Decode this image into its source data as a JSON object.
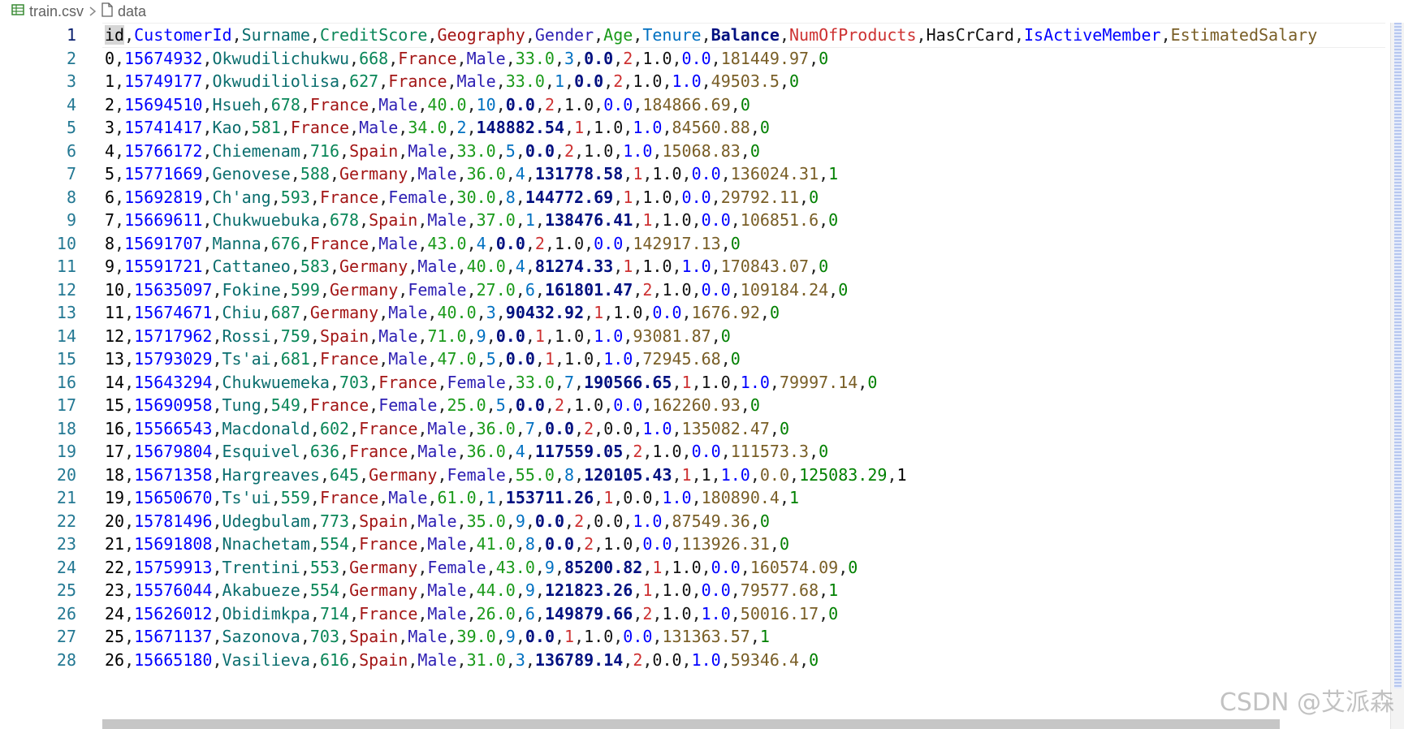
{
  "breadcrumb": {
    "file": "train.csv",
    "symbol": "data",
    "file_icon": "table-icon",
    "symbol_icon": "file-icon"
  },
  "colors": {
    "line_number": "#237893",
    "line_number_active": "#0b216f",
    "columns": [
      "#000000",
      "#0000ff",
      "#0b6e6e",
      "#098658",
      "#a31515",
      "#2d1fb3",
      "#1a9a1a",
      "#0070c1",
      "#001080",
      "#cd3131",
      "#111111",
      "#0000ff",
      "#795e26",
      "#008000"
    ]
  },
  "editor": {
    "header": [
      "id",
      "CustomerId",
      "Surname",
      "CreditScore",
      "Geography",
      "Gender",
      "Age",
      "Tenure",
      "Balance",
      "NumOfProducts",
      "HasCrCard",
      "IsActiveMember",
      "EstimatedSalary"
    ],
    "rows": [
      [
        "0",
        "15674932",
        "Okwudilichukwu",
        "668",
        "France",
        "Male",
        "33.0",
        "3",
        "0.0",
        "2",
        "1.0",
        "0.0",
        "181449.97",
        "0"
      ],
      [
        "1",
        "15749177",
        "Okwudiliolisa",
        "627",
        "France",
        "Male",
        "33.0",
        "1",
        "0.0",
        "2",
        "1.0",
        "1.0",
        "49503.5",
        "0"
      ],
      [
        "2",
        "15694510",
        "Hsueh",
        "678",
        "France",
        "Male",
        "40.0",
        "10",
        "0.0",
        "2",
        "1.0",
        "0.0",
        "184866.69",
        "0"
      ],
      [
        "3",
        "15741417",
        "Kao",
        "581",
        "France",
        "Male",
        "34.0",
        "2",
        "148882.54",
        "1",
        "1.0",
        "1.0",
        "84560.88",
        "0"
      ],
      [
        "4",
        "15766172",
        "Chiemenam",
        "716",
        "Spain",
        "Male",
        "33.0",
        "5",
        "0.0",
        "2",
        "1.0",
        "1.0",
        "15068.83",
        "0"
      ],
      [
        "5",
        "15771669",
        "Genovese",
        "588",
        "Germany",
        "Male",
        "36.0",
        "4",
        "131778.58",
        "1",
        "1.0",
        "0.0",
        "136024.31",
        "1"
      ],
      [
        "6",
        "15692819",
        "Ch'ang",
        "593",
        "France",
        "Female",
        "30.0",
        "8",
        "144772.69",
        "1",
        "1.0",
        "0.0",
        "29792.11",
        "0"
      ],
      [
        "7",
        "15669611",
        "Chukwuebuka",
        "678",
        "Spain",
        "Male",
        "37.0",
        "1",
        "138476.41",
        "1",
        "1.0",
        "0.0",
        "106851.6",
        "0"
      ],
      [
        "8",
        "15691707",
        "Manna",
        "676",
        "France",
        "Male",
        "43.0",
        "4",
        "0.0",
        "2",
        "1.0",
        "0.0",
        "142917.13",
        "0"
      ],
      [
        "9",
        "15591721",
        "Cattaneo",
        "583",
        "Germany",
        "Male",
        "40.0",
        "4",
        "81274.33",
        "1",
        "1.0",
        "1.0",
        "170843.07",
        "0"
      ],
      [
        "10",
        "15635097",
        "Fokine",
        "599",
        "Germany",
        "Female",
        "27.0",
        "6",
        "161801.47",
        "2",
        "1.0",
        "0.0",
        "109184.24",
        "0"
      ],
      [
        "11",
        "15674671",
        "Chiu",
        "687",
        "Germany",
        "Male",
        "40.0",
        "3",
        "90432.92",
        "1",
        "1.0",
        "0.0",
        "1676.92",
        "0"
      ],
      [
        "12",
        "15717962",
        "Rossi",
        "759",
        "Spain",
        "Male",
        "71.0",
        "9",
        "0.0",
        "1",
        "1.0",
        "1.0",
        "93081.87",
        "0"
      ],
      [
        "13",
        "15793029",
        "Ts'ai",
        "681",
        "France",
        "Male",
        "47.0",
        "5",
        "0.0",
        "1",
        "1.0",
        "1.0",
        "72945.68",
        "0"
      ],
      [
        "14",
        "15643294",
        "Chukwuemeka",
        "703",
        "France",
        "Female",
        "33.0",
        "7",
        "190566.65",
        "1",
        "1.0",
        "1.0",
        "79997.14",
        "0"
      ],
      [
        "15",
        "15690958",
        "Tung",
        "549",
        "France",
        "Female",
        "25.0",
        "5",
        "0.0",
        "2",
        "1.0",
        "0.0",
        "162260.93",
        "0"
      ],
      [
        "16",
        "15566543",
        "Macdonald",
        "602",
        "France",
        "Male",
        "36.0",
        "7",
        "0.0",
        "2",
        "0.0",
        "1.0",
        "135082.47",
        "0"
      ],
      [
        "17",
        "15679804",
        "Esquivel",
        "636",
        "France",
        "Male",
        "36.0",
        "4",
        "117559.05",
        "2",
        "1.0",
        "0.0",
        "111573.3",
        "0"
      ],
      [
        "18",
        "15671358",
        "Hargreaves",
        "645",
        "Germany",
        "Female",
        "55.0",
        "8",
        "120105.43",
        "1",
        "1",
        "1.0",
        "0.0",
        "125083.29",
        "1"
      ],
      [
        "19",
        "15650670",
        "Ts'ui",
        "559",
        "France",
        "Male",
        "61.0",
        "1",
        "153711.26",
        "1",
        "0.0",
        "1.0",
        "180890.4",
        "1"
      ],
      [
        "20",
        "15781496",
        "Udegbulam",
        "773",
        "Spain",
        "Male",
        "35.0",
        "9",
        "0.0",
        "2",
        "0.0",
        "1.0",
        "87549.36",
        "0"
      ],
      [
        "21",
        "15691808",
        "Nnachetam",
        "554",
        "France",
        "Male",
        "41.0",
        "8",
        "0.0",
        "2",
        "1.0",
        "0.0",
        "113926.31",
        "0"
      ],
      [
        "22",
        "15759913",
        "Trentini",
        "553",
        "Germany",
        "Female",
        "43.0",
        "9",
        "85200.82",
        "1",
        "1.0",
        "0.0",
        "160574.09",
        "0"
      ],
      [
        "23",
        "15576044",
        "Akabueze",
        "554",
        "Germany",
        "Male",
        "44.0",
        "9",
        "121823.26",
        "1",
        "1.0",
        "0.0",
        "79577.68",
        "1"
      ],
      [
        "24",
        "15626012",
        "Obidimkpa",
        "714",
        "France",
        "Male",
        "26.0",
        "6",
        "149879.66",
        "2",
        "1.0",
        "1.0",
        "50016.17",
        "0"
      ],
      [
        "25",
        "15671137",
        "Sazonova",
        "703",
        "Spain",
        "Male",
        "39.0",
        "9",
        "0.0",
        "1",
        "1.0",
        "0.0",
        "131363.57",
        "1"
      ],
      [
        "26",
        "15665180",
        "Vasilieva",
        "616",
        "Spain",
        "Male",
        "31.0",
        "3",
        "136789.14",
        "2",
        "0.0",
        "1.0",
        "59346.4",
        "0"
      ]
    ]
  },
  "watermark": "CSDN @艾派森"
}
